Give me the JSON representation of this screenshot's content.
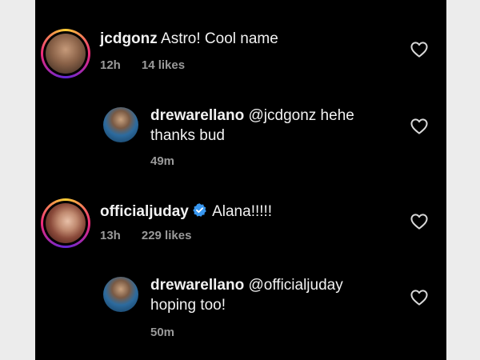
{
  "comments": [
    {
      "username": "jcdgonz",
      "text": "Astro! Cool name",
      "time": "12h",
      "likes": "14 likes"
    },
    {
      "username": "drewarellano",
      "text_line1": "@jcdgonz hehe",
      "text_line2": "thanks bud",
      "time": "49m"
    },
    {
      "username": "officialjuday",
      "text": "Alana!!!!!",
      "time": "13h",
      "likes": "229 likes"
    },
    {
      "username": "drewarellano",
      "text_line1": "@officialjuday",
      "text_line2": "hoping too!",
      "time": "50m"
    }
  ],
  "colors": {
    "background": "#000000",
    "text": "#f2f2f2",
    "meta": "#9a9a9a",
    "verified": "#3897f0"
  },
  "icons": {
    "like": "heart-outline-icon",
    "verified": "verified-badge-icon"
  }
}
